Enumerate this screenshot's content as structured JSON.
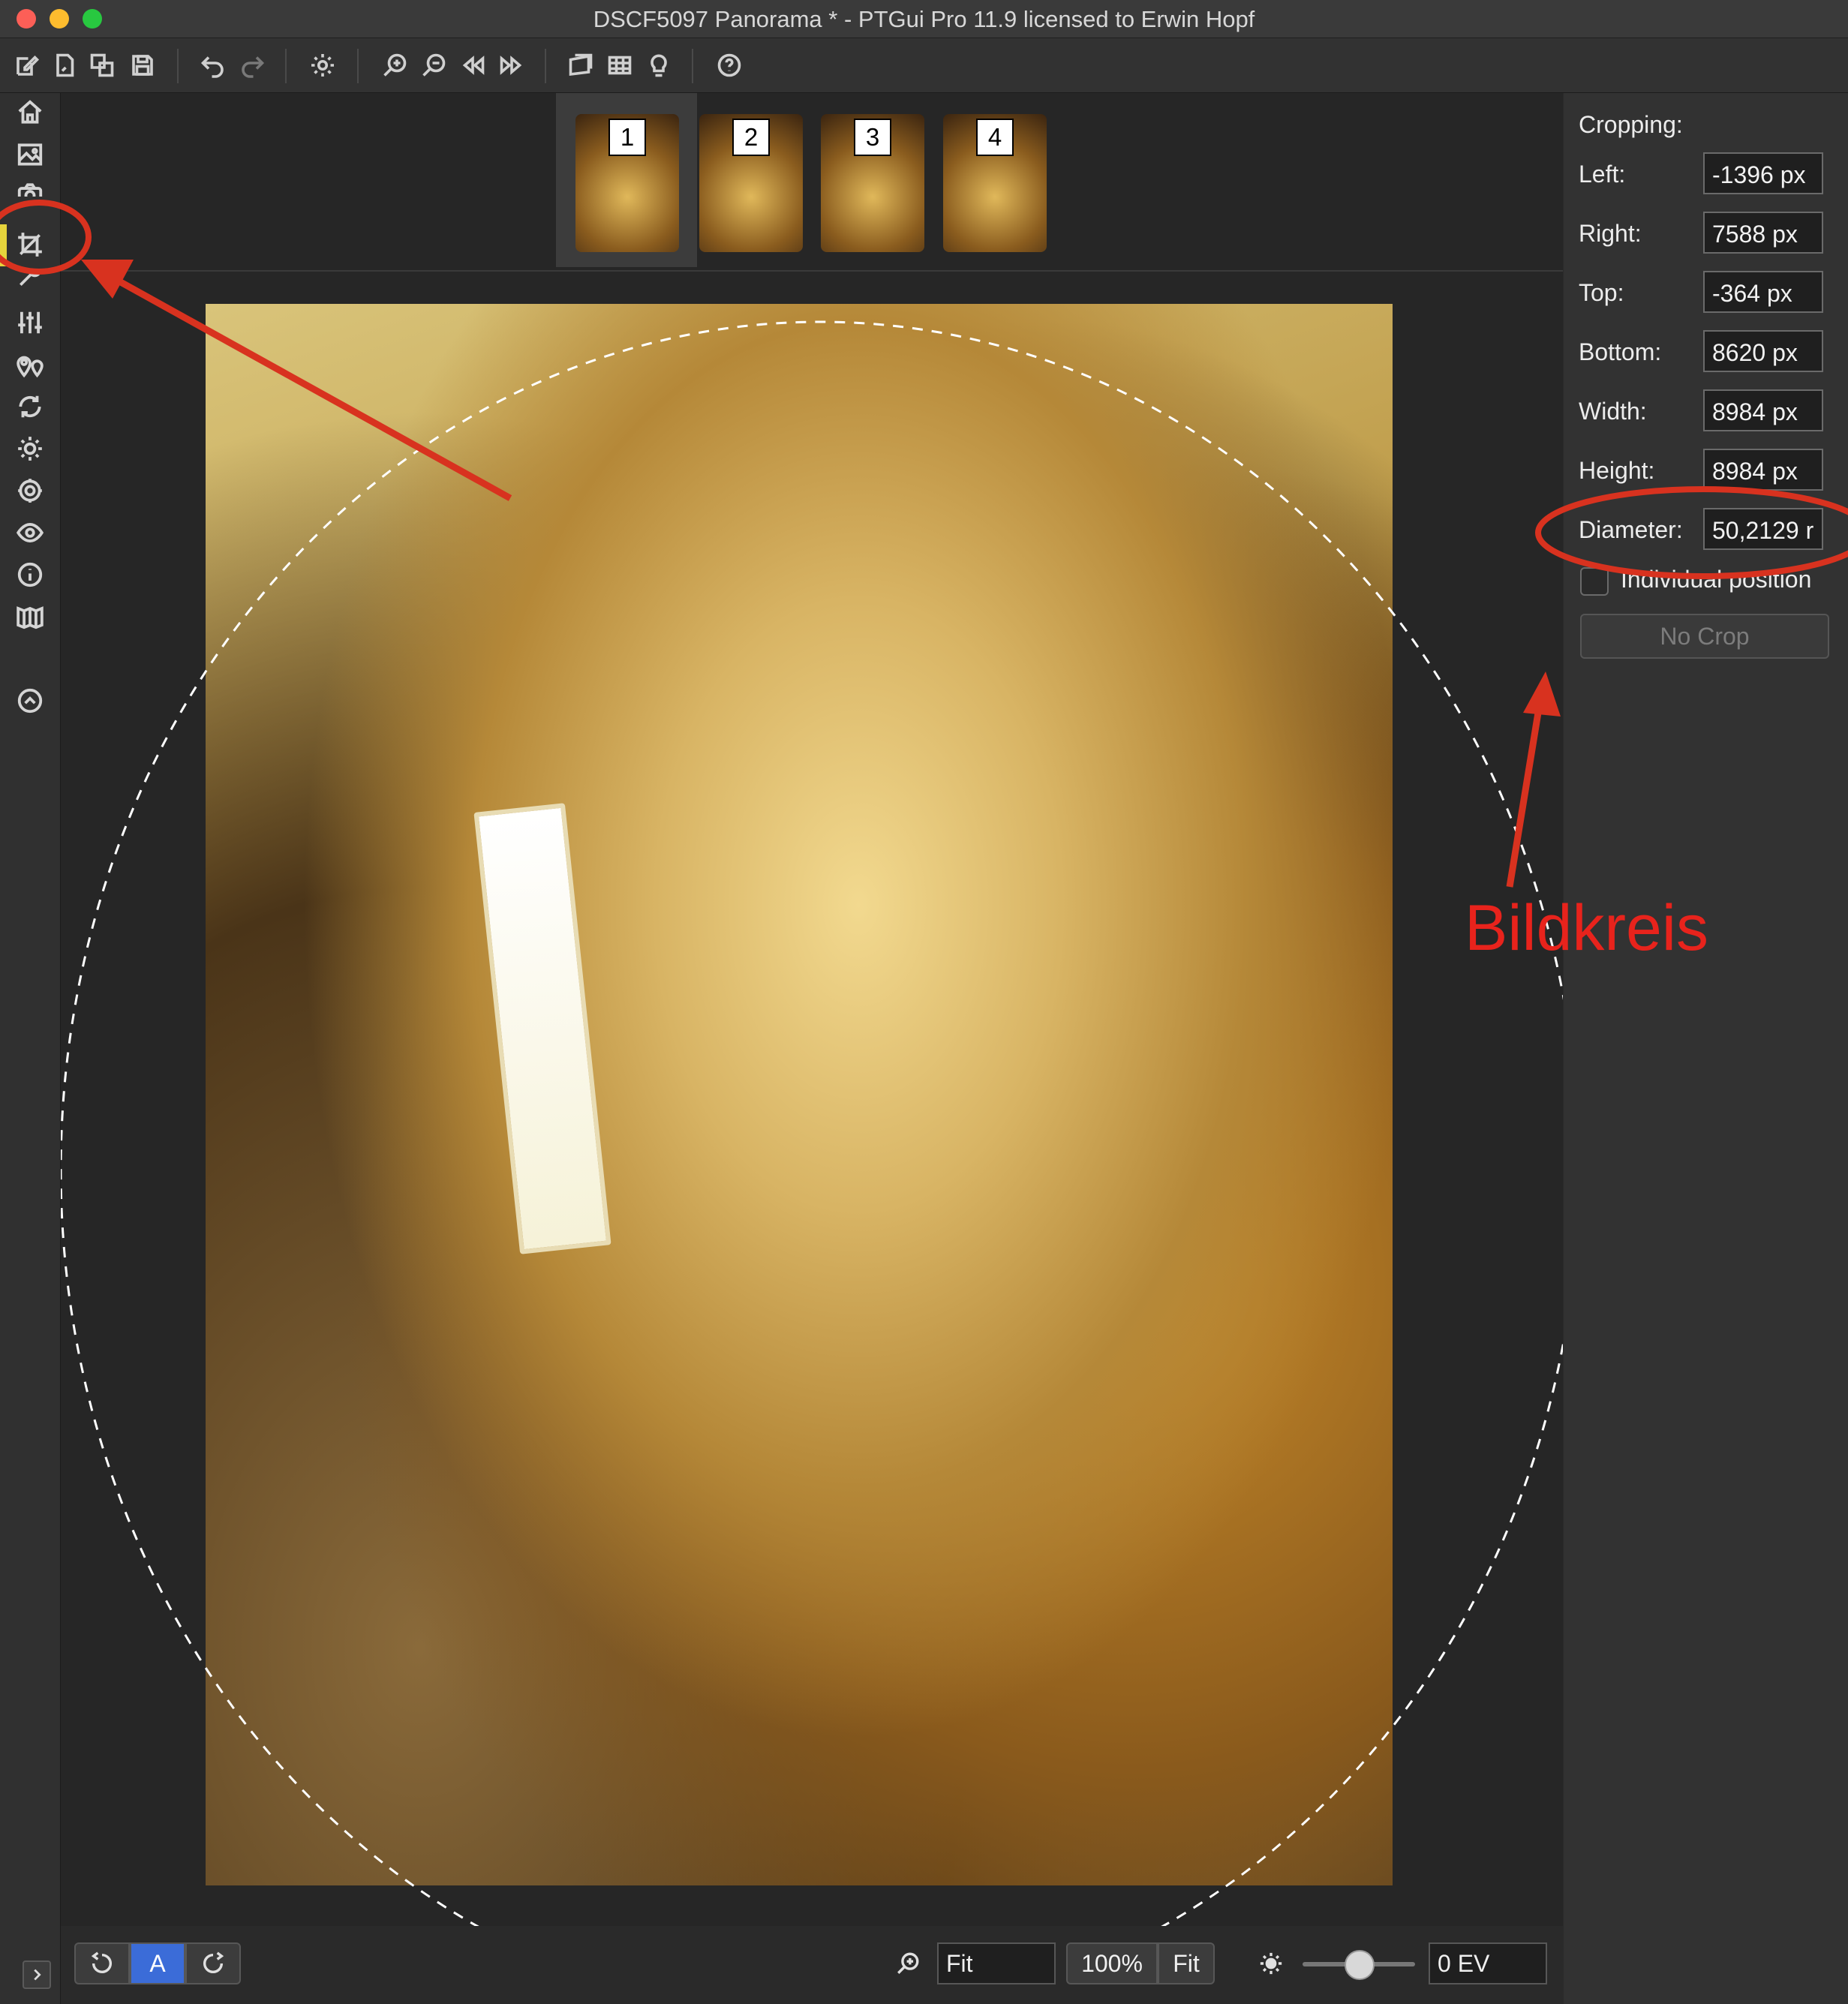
{
  "window": {
    "title": "DSCF5097 Panorama * - PTGui Pro 11.9 licensed to Erwin Hopf"
  },
  "toolbar": {
    "icons": [
      "new-project-icon",
      "open-icon",
      "duplicate-icon",
      "save-icon",
      "undo-icon",
      "redo-icon",
      "settings-icon",
      "zoom-in-icon",
      "zoom-out-icon",
      "previous-icon",
      "next-icon",
      "panorama-editor-icon",
      "grid-icon",
      "tips-icon",
      "help-icon"
    ]
  },
  "sidebar": {
    "icons": [
      "home-icon",
      "images-icon",
      "camera-icon",
      "crop-icon",
      "tools-icon",
      "adjust-icon",
      "control-points-icon",
      "optimize-icon",
      "exposure-icon",
      "settings-icon",
      "preview-icon",
      "info-icon",
      "create-panorama-icon",
      "collapse-up-icon"
    ],
    "active": "crop"
  },
  "thumbnails": [
    {
      "label": "1"
    },
    {
      "label": "2"
    },
    {
      "label": "3"
    },
    {
      "label": "4"
    }
  ],
  "panel": {
    "heading": "Cropping:",
    "fields": {
      "left": {
        "label": "Left:",
        "value": "-1396 px"
      },
      "right": {
        "label": "Right:",
        "value": "7588 px"
      },
      "top": {
        "label": "Top:",
        "value": "-364 px"
      },
      "bottom": {
        "label": "Bottom:",
        "value": "8620 px"
      },
      "width": {
        "label": "Width:",
        "value": "8984 px"
      },
      "height": {
        "label": "Height:",
        "value": "8984 px"
      },
      "diameter": {
        "label": "Diameter:",
        "value": "50,2129 r"
      }
    },
    "individual_label": "Individual position",
    "no_crop_label": "No Crop"
  },
  "bottombar": {
    "auto_label": "A",
    "zoom_value": "Fit",
    "zoom_100_label": "100%",
    "zoom_fit_label": "Fit",
    "exposure_value": "0 EV"
  },
  "annotations": {
    "bildkreis_label": "Bildkreis",
    "color": "#e8231c"
  }
}
